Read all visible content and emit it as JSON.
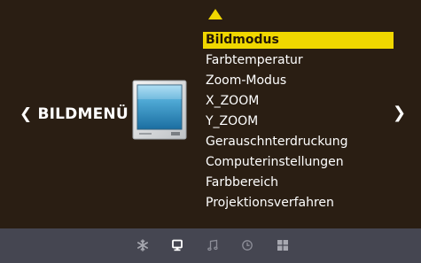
{
  "menu_title": "BILDMENÜ",
  "menu_items": [
    "Bildmodus",
    "Farbtemperatur",
    "Zoom-Modus",
    "X_ZOOM",
    "Y_ZOOM",
    "Gerauschnterdruckung",
    "Computerinstellungen",
    "Farbbereich",
    "Projektionsverfahren"
  ],
  "selected_item": "Bildmodus",
  "bottom_tabs": [
    {
      "icon": "snowflake-icon",
      "active": false
    },
    {
      "icon": "monitor-icon",
      "active": true
    },
    {
      "icon": "music-note-icon",
      "active": false
    },
    {
      "icon": "clock-icon",
      "active": false
    },
    {
      "icon": "grid-icon",
      "active": false
    }
  ],
  "colors": {
    "background": "#2a1e13",
    "highlight": "#f0d700",
    "bottom_bar": "#454651"
  }
}
